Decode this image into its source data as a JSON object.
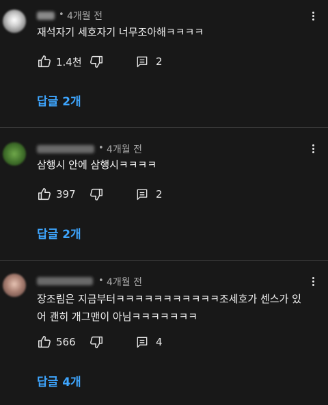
{
  "comments": [
    {
      "time": "4개월 전",
      "dot": "•",
      "text": "재석자기 세호자기 너무조아해ㅋㅋㅋㅋ",
      "likes": "1.4천",
      "reply_count": "2",
      "replies_label": "답글 2개"
    },
    {
      "time": "4개월 전",
      "dot": "•",
      "text": "삼행시 안에 삼행시ㅋㅋㅋㅋ",
      "likes": "397",
      "reply_count": "2",
      "replies_label": "답글 2개"
    },
    {
      "time": "4개월 전",
      "dot": "•",
      "text": "장조림은 지금부터ㅋㅋㅋㅋㅋㅋㅋㅋㅋㅋㅋ조세호가 센스가 있어 괜히 개그맨이 아님ㅋㅋㅋㅋㅋㅋㅋ",
      "likes": "566",
      "reply_count": "4",
      "replies_label": "답글 4개"
    }
  ],
  "icons": {
    "like": "thumbs-up-icon",
    "dislike": "thumbs-down-icon",
    "reply": "comment-icon",
    "more": "more-vert-icon"
  },
  "colors": {
    "background": "#181818",
    "accent": "#3ea6ff",
    "secondary_text": "#aaaaaa"
  }
}
